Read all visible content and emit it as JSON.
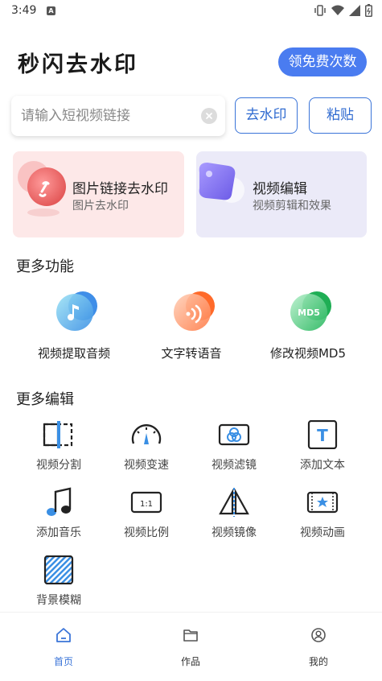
{
  "status_bar": {
    "time": "3:49"
  },
  "header": {
    "title": "秒闪去水印",
    "free_button": "领免费次数"
  },
  "search": {
    "placeholder": "请输入短视频链接",
    "value": ""
  },
  "actions": {
    "remove_watermark": "去水印",
    "paste": "粘贴"
  },
  "cards": [
    {
      "title": "图片链接去水印",
      "subtitle": "图片去水印"
    },
    {
      "title": "视频编辑",
      "subtitle": "视频剪辑和效果"
    }
  ],
  "more_functions": {
    "title": "更多功能",
    "items": [
      {
        "label": "视频提取音频",
        "icon": "music-note-icon"
      },
      {
        "label": "文字转语音",
        "icon": "sound-wave-icon"
      },
      {
        "label": "修改视频MD5",
        "icon": "md5-icon",
        "badge": "MD5"
      }
    ]
  },
  "more_edit": {
    "title": "更多编辑",
    "items": [
      {
        "label": "视频分割",
        "icon": "split-icon"
      },
      {
        "label": "视频变速",
        "icon": "speed-gauge-icon"
      },
      {
        "label": "视频滤镜",
        "icon": "filter-icon"
      },
      {
        "label": "添加文本",
        "icon": "text-icon",
        "glyph": "T"
      },
      {
        "label": "添加音乐",
        "icon": "music-icon"
      },
      {
        "label": "视频比例",
        "icon": "ratio-icon",
        "glyph": "1:1"
      },
      {
        "label": "视频镜像",
        "icon": "mirror-icon"
      },
      {
        "label": "视频动画",
        "icon": "animation-icon"
      },
      {
        "label": "背景模糊",
        "icon": "blur-icon"
      }
    ]
  },
  "bottom_nav": [
    {
      "label": "首页",
      "icon": "home-icon",
      "active": true
    },
    {
      "label": "作品",
      "icon": "folder-icon",
      "active": false
    },
    {
      "label": "我的",
      "icon": "profile-icon",
      "active": false
    }
  ],
  "colors": {
    "accent": "#4a7cf0",
    "accent_text": "#2f6ad0",
    "pink_card": "#fde8e8",
    "purple_card": "#ebeaf8"
  }
}
